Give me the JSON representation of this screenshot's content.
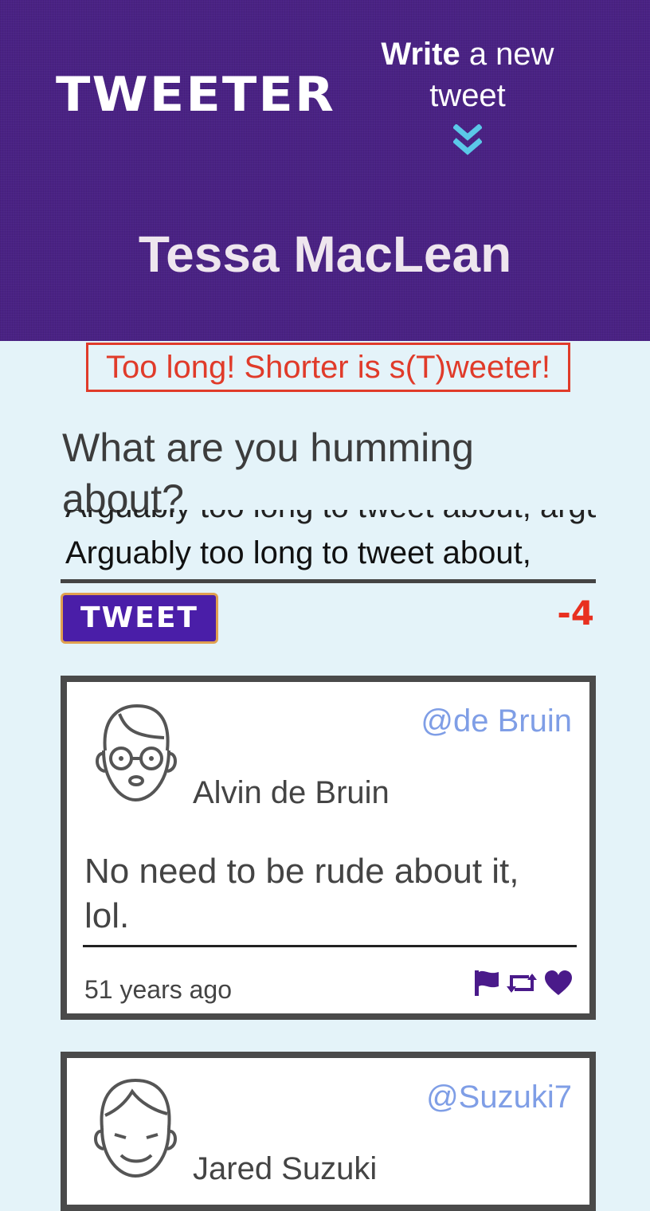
{
  "header": {
    "logo": "TWEETER",
    "write_bold": "Write",
    "write_rest": " a new tweet",
    "profile_name": "Tessa MacLean",
    "chevron_icon": "double-chevron-down-icon"
  },
  "composer": {
    "error": "Too long! Shorter is s(T)weeter!",
    "prompt": "What are you humming about?",
    "text_hidden_line": "Arguably too long to tweet about, arguably",
    "text_visible": "Arguably too long to tweet about,",
    "submit_label": "TWEET",
    "counter": "-4"
  },
  "tweets": [
    {
      "handle": "@de Bruin",
      "name": "Alvin de Bruin",
      "content": "No need to be rude about it, lol.",
      "time": "51 years ago",
      "icons": [
        "flag-icon",
        "retweet-icon",
        "heart-icon"
      ]
    },
    {
      "handle": "@Suzuki7",
      "name": "Jared Suzuki"
    }
  ],
  "colors": {
    "header_bg": "#4a2284",
    "page_bg": "#e4f3f9",
    "error": "#e03b2a",
    "handle": "#7f9ee6",
    "action_icons": "#4a1a8a",
    "chevron": "#5bc8e8"
  }
}
